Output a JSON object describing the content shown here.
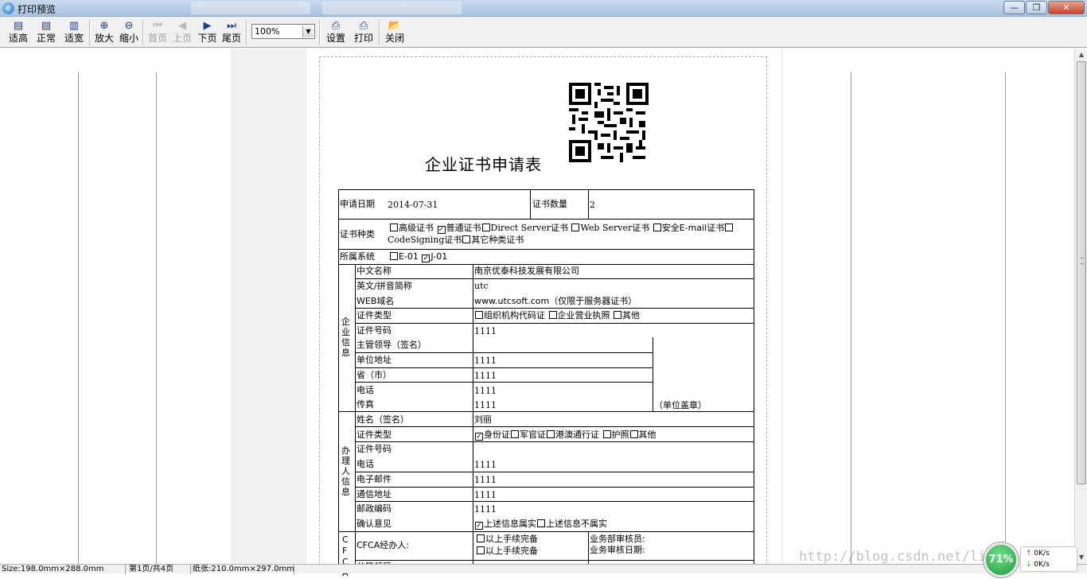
{
  "window": {
    "title": "打印预览",
    "controls": {
      "minimize": "—",
      "maximize": "❐",
      "close": "✕"
    }
  },
  "toolbar": {
    "buttons": [
      {
        "label": "适高",
        "icon": "fit-height-icon",
        "enabled": true
      },
      {
        "label": "正常",
        "icon": "normal-size-icon",
        "enabled": true
      },
      {
        "label": "适宽",
        "icon": "fit-width-icon",
        "enabled": true
      },
      {
        "label": "放大",
        "icon": "zoom-in-icon",
        "enabled": true
      },
      {
        "label": "缩小",
        "icon": "zoom-out-icon",
        "enabled": true
      },
      {
        "label": "首页",
        "icon": "first-page-icon",
        "enabled": false
      },
      {
        "label": "上页",
        "icon": "prev-page-icon",
        "enabled": false
      },
      {
        "label": "下页",
        "icon": "next-page-icon",
        "enabled": true
      },
      {
        "label": "尾页",
        "icon": "last-page-icon",
        "enabled": true
      },
      {
        "label": "设置",
        "icon": "page-setup-icon",
        "enabled": true
      },
      {
        "label": "打印",
        "icon": "printer-icon",
        "enabled": true
      },
      {
        "label": "关闭",
        "icon": "close-folder-icon",
        "enabled": true
      }
    ],
    "zoom_value": "100%"
  },
  "document": {
    "title": "企业证书申请表",
    "apply_date_label": "申请日期",
    "apply_date": "2014-07-31",
    "cert_count_label": "证书数量",
    "cert_count": "2",
    "cert_type_label": "证书种类",
    "cert_types": [
      {
        "label": "高级证书",
        "checked": false
      },
      {
        "label": "普通证书",
        "checked": true
      },
      {
        "label": "Direct Server证书",
        "checked": false
      },
      {
        "label": "Web Server证书",
        "checked": false
      },
      {
        "label": "安全E-mail证书",
        "checked": false
      },
      {
        "label": "CodeSigning证书",
        "checked": false
      },
      {
        "label": "其它种类证书",
        "checked": false
      }
    ],
    "system_label": "所属系统",
    "systems": [
      {
        "label": "E-01",
        "checked": false
      },
      {
        "label": "J-01",
        "checked": true
      }
    ],
    "company_section_label": "企业信息",
    "company": {
      "cn_name_label": "中文名称",
      "cn_name": "南京优泰科技发展有限公司",
      "en_name_label": "英文/拼音简称",
      "en_name": "utc",
      "web_label": "WEB域名",
      "web": "www.utcsoft.com（仅限于服务器证书）",
      "id_type_label": "证件类型",
      "id_types": [
        {
          "label": "组织机构代码证",
          "checked": false
        },
        {
          "label": "企业营业执照",
          "checked": false
        },
        {
          "label": "其他",
          "checked": false
        }
      ],
      "id_no_label": "证件号码",
      "id_no": "1111",
      "leader_label": "主管领导（签名）",
      "address_label": "单位地址",
      "address": "1111",
      "province_label": "省（市）",
      "province": "1111",
      "phone_label": "电话",
      "phone": "1111",
      "fax_label": "传真",
      "fax": "1111",
      "seal_label": "（单位盖章）"
    },
    "agent_section_label": "办理人信息",
    "agent": {
      "name_label": "姓名（签名）",
      "name": "刘丽",
      "id_type_label": "证件类型",
      "id_types": [
        {
          "label": "身份证",
          "checked": true
        },
        {
          "label": "军官证",
          "checked": false
        },
        {
          "label": "港澳通行证",
          "checked": false
        },
        {
          "label": "护照",
          "checked": false
        },
        {
          "label": "其他",
          "checked": false
        }
      ],
      "id_no_label": "证件号码",
      "phone_label": "电话",
      "phone": "1111",
      "email_label": "电子邮件",
      "email": "1111",
      "address_label": "通信地址",
      "address": "1111",
      "zip_label": "邮政编码",
      "zip": "1111",
      "confirm_label": "确认意见",
      "confirm_options": [
        {
          "label": "上述信息属实",
          "checked": true
        },
        {
          "label": "上述信息不属实",
          "checked": false
        }
      ]
    },
    "cfca_section_label": "CFCA",
    "cfca": {
      "agent_label": "CFCA经办人:",
      "checks": [
        {
          "label": "以上手续完备",
          "checked": false
        },
        {
          "label": "以上手续完备",
          "checked": false
        }
      ],
      "reviewer_label": "业务部审核员:",
      "review_date_label": "业务审核日期:",
      "partial_row_label": "分管领导"
    }
  },
  "statusbar": {
    "size": "Size:198.0mm×288.0mm",
    "page": "第1页/共4页",
    "paper": "纸张:210.0mm×297.0mm"
  },
  "watermark": "http://blog.csdn.net/liuyang_sky",
  "net_monitor": {
    "percent": "71%",
    "up": "0K/s",
    "down": "0K/s"
  }
}
